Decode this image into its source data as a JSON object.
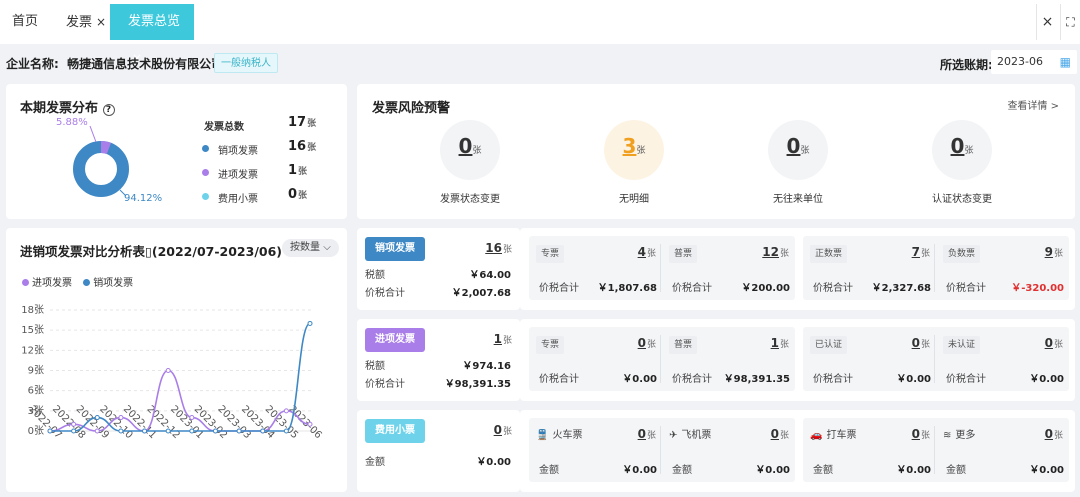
{
  "tabs": [
    {
      "label": "首页",
      "closable": false
    },
    {
      "label": "发票",
      "closable": true
    },
    {
      "label": "发票总览",
      "closable": true,
      "active": true
    }
  ],
  "tab_close_symbol": "×",
  "header": {
    "company_label": "企业名称:",
    "company_name": "畅捷通信息技术股份有限公司",
    "taxpayer_type": "一般纳税人",
    "period_label": "所选账期:",
    "period_value": "2023-06"
  },
  "distribution": {
    "title": "本期发票分布",
    "pct_small": "5.88%",
    "pct_large": "94.12%",
    "rows": [
      {
        "label": "发票总数",
        "value": "17",
        "unit": "张",
        "color": ""
      },
      {
        "label": "销项发票",
        "value": "16",
        "unit": "张",
        "color": "#3d88c5"
      },
      {
        "label": "进项发票",
        "value": "1",
        "unit": "张",
        "color": "#a97ee8"
      },
      {
        "label": "费用小票",
        "value": "0",
        "unit": "张",
        "color": "#6ed3ea"
      }
    ]
  },
  "risk": {
    "title": "发票风险预警",
    "detail_link": "查看详情 >",
    "items": [
      {
        "value": "0",
        "unit": "张",
        "label": "发票状态变更",
        "highlight": false
      },
      {
        "value": "3",
        "unit": "张",
        "label": "无明细",
        "highlight": true
      },
      {
        "value": "0",
        "unit": "张",
        "label": "无往来单位",
        "highlight": false
      },
      {
        "value": "0",
        "unit": "张",
        "label": "认证状态变更",
        "highlight": false
      }
    ]
  },
  "trend": {
    "title": "进销项发票对比分析表▯(2022/07-2023/06)",
    "sort_label": "按数量",
    "legend": [
      "进项发票",
      "销项发票"
    ]
  },
  "chart_data": {
    "type": "line",
    "x": [
      "2022-07",
      "2022-08",
      "2022-09",
      "2022-10",
      "2022-11",
      "2022-12",
      "2023-01",
      "2023-02",
      "2023-03",
      "2023-04",
      "2023-05",
      "2023-06"
    ],
    "y_ticks": [
      "0张",
      "3张",
      "6张",
      "9张",
      "12张",
      "15张",
      "18张"
    ],
    "ylim": [
      0,
      18
    ],
    "series": [
      {
        "name": "进项发票",
        "color": "#a97ee8",
        "values": [
          0,
          1,
          0,
          2,
          0,
          9,
          2,
          0,
          0,
          0,
          3,
          1
        ]
      },
      {
        "name": "销项发票",
        "color": "#3d88c5",
        "values": [
          0,
          0,
          2,
          0,
          0,
          0,
          0,
          0,
          0,
          0,
          0,
          16
        ]
      }
    ]
  },
  "sales": {
    "pill": "销项发票",
    "count": "16",
    "unit": "张",
    "rows": [
      {
        "label": "税额",
        "value": "￥64.00"
      },
      {
        "label": "价税合计",
        "value": "￥2,007.68"
      }
    ],
    "panels": [
      [
        {
          "tag": "专票",
          "count": "4",
          "sub_label": "价税合计",
          "sub_value": "￥1,807.68"
        },
        {
          "tag": "普票",
          "count": "12",
          "sub_label": "价税合计",
          "sub_value": "￥200.00"
        }
      ],
      [
        {
          "tag": "正数票",
          "count": "7",
          "sub_label": "价税合计",
          "sub_value": "￥2,327.68"
        },
        {
          "tag": "负数票",
          "count": "9",
          "sub_label": "价税合计",
          "sub_value": "￥-320.00",
          "negative": true
        }
      ]
    ]
  },
  "purchase": {
    "pill": "进项发票",
    "count": "1",
    "unit": "张",
    "rows": [
      {
        "label": "税额",
        "value": "￥974.16"
      },
      {
        "label": "价税合计",
        "value": "￥98,391.35"
      }
    ],
    "panels": [
      [
        {
          "tag": "专票",
          "count": "0",
          "sub_label": "价税合计",
          "sub_value": "￥0.00"
        },
        {
          "tag": "普票",
          "count": "1",
          "sub_label": "价税合计",
          "sub_value": "￥98,391.35"
        }
      ],
      [
        {
          "tag": "已认证",
          "count": "0",
          "sub_label": "价税合计",
          "sub_value": "￥0.00"
        },
        {
          "tag": "未认证",
          "count": "0",
          "sub_label": "价税合计",
          "sub_value": "￥0.00"
        }
      ]
    ]
  },
  "expense": {
    "pill": "费用小票",
    "count": "0",
    "unit": "张",
    "rows": [
      {
        "label": "金额",
        "value": "￥0.00"
      }
    ],
    "panels": [
      [
        {
          "icon": "train-icon",
          "tag": "火车票",
          "count": "0",
          "sub_label": "金额",
          "sub_value": "￥0.00"
        },
        {
          "icon": "plane-icon",
          "tag": "飞机票",
          "count": "0",
          "sub_label": "金额",
          "sub_value": "￥0.00"
        }
      ],
      [
        {
          "icon": "car-icon",
          "tag": "打车票",
          "count": "0",
          "sub_label": "金额",
          "sub_value": "￥0.00"
        },
        {
          "icon": "layers-icon",
          "tag": "更多",
          "count": "0",
          "sub_label": "金额",
          "sub_value": "￥0.00"
        }
      ]
    ]
  },
  "colors": {
    "accent": "#3dc8dc",
    "sales": "#3d88c5",
    "purchase": "#a97ee8",
    "expense": "#6ed3ea",
    "warn": "#f0a020",
    "negative": "#e03030"
  }
}
